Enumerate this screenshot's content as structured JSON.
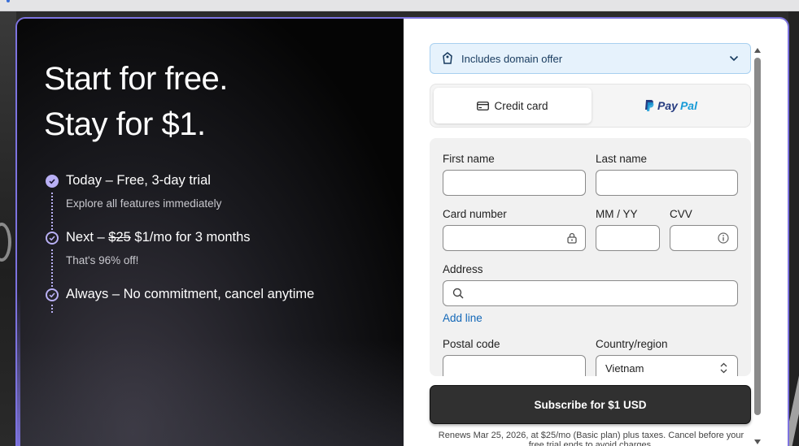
{
  "headline": {
    "line1": "Start for free.",
    "line2": "Stay for $1."
  },
  "steps": [
    {
      "title": "Today – Free, 3-day trial",
      "sub": "Explore all features immediately"
    },
    {
      "title_prefix": "Next –",
      "title_strike": "$25",
      "title_rest": "$1/mo for 3 months",
      "sub": "That's 96% off!"
    },
    {
      "title": "Always – No commitment, cancel anytime"
    }
  ],
  "domain_offer": {
    "label": "Includes domain offer",
    "icon": "domain-tag-icon"
  },
  "payment_tabs": {
    "credit_card": "Credit card",
    "paypal_pay": "Pay",
    "paypal_pal": "Pal"
  },
  "form": {
    "first_name": "First name",
    "last_name": "Last name",
    "card_number": "Card number",
    "mm_yy": "MM / YY",
    "cvv": "CVV",
    "address": "Address",
    "add_line": "Add line",
    "postal_code": "Postal code",
    "country_region": "Country/region",
    "country_value": "Vietnam"
  },
  "subscribe_label": "Subscribe for $1 USD",
  "renew_text": "Renews Mar 25, 2026, at $25/mo (Basic plan) plus taxes. Cancel before your free trial ends to avoid charges.",
  "colors": {
    "accent": "#b9b0f5",
    "border_glow": "#7d73e0",
    "link": "#1368b8",
    "paypal_dark": "#253b80",
    "paypal_light": "#179bd7"
  }
}
